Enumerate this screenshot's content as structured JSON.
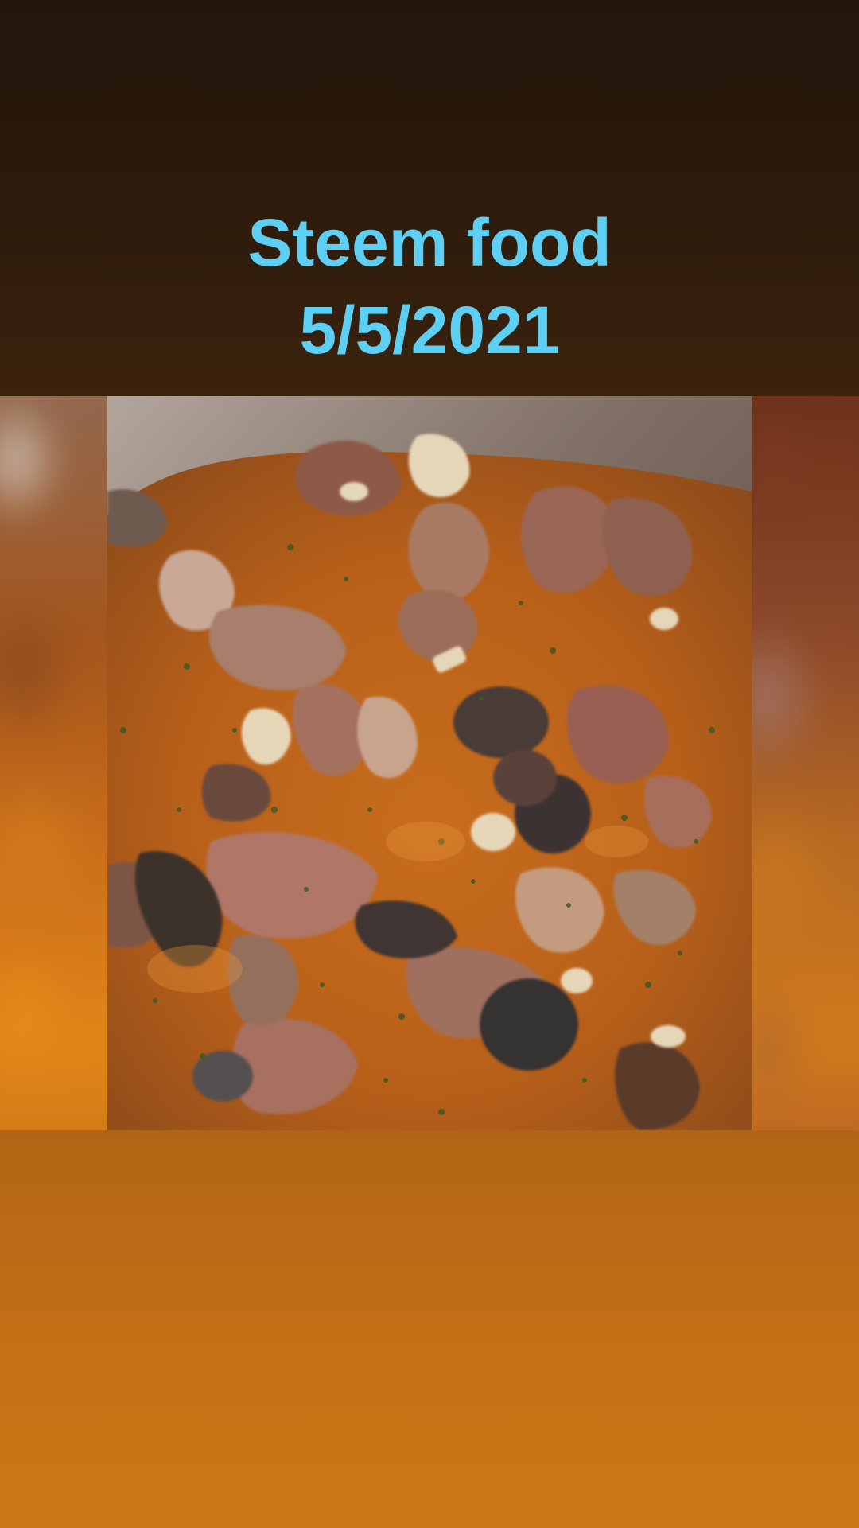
{
  "story": {
    "caption_line1": "Steem food",
    "caption_line2": "5/5/2021",
    "caption_color": "#5ccff3"
  },
  "photo": {
    "subject": "stew-photo"
  }
}
